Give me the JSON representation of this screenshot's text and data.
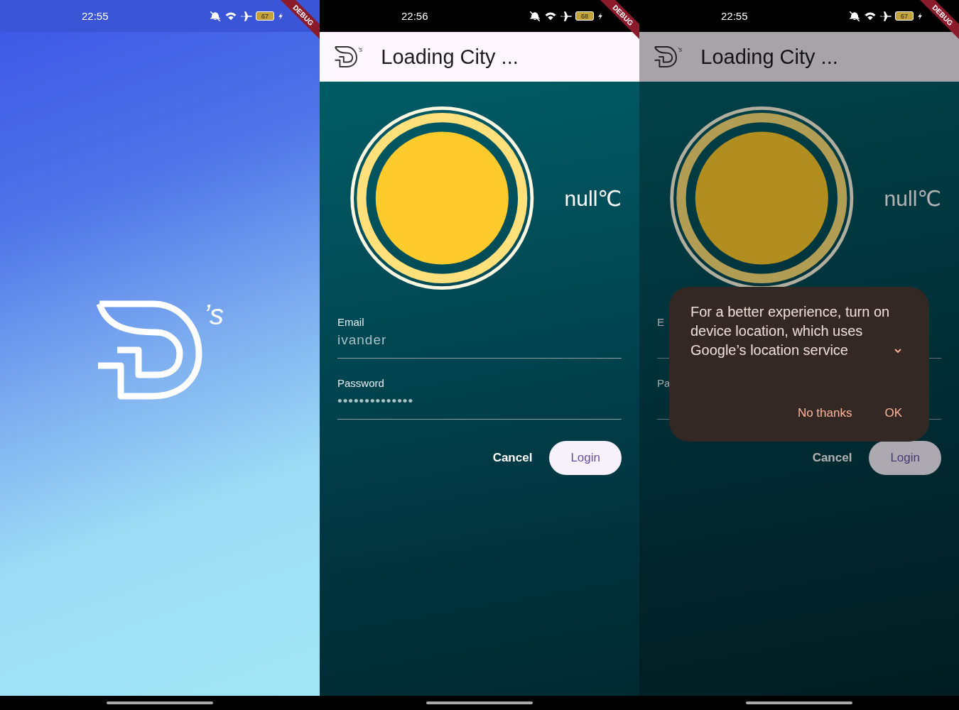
{
  "screens": [
    {
      "kind": "splash",
      "status_bar": {
        "time": "22:55",
        "battery": "67"
      },
      "debug_banner": "DEBUG",
      "logo_suffix": "’s"
    },
    {
      "kind": "login",
      "dimmed": false,
      "status_bar": {
        "time": "22:56",
        "battery": "68"
      },
      "debug_banner": "DEBUG",
      "app_bar": {
        "logo_suffix": "’s",
        "title": "Loading City ..."
      },
      "weather": {
        "temperature": "null℃"
      },
      "fields": [
        {
          "label": "Email",
          "value": "ivander"
        },
        {
          "label": "Password",
          "value": "••••••••••••••"
        }
      ],
      "buttons": [
        {
          "kind": "text",
          "label": "Cancel"
        },
        {
          "kind": "filled",
          "label": "Login"
        }
      ]
    },
    {
      "kind": "login",
      "dimmed": true,
      "status_bar": {
        "time": "22:55",
        "battery": "67"
      },
      "debug_banner": "DEBUG",
      "app_bar": {
        "logo_suffix": "’s",
        "title": "Loading City ..."
      },
      "weather": {
        "temperature": "null℃"
      },
      "fields": [
        {
          "label": "E"
        },
        {
          "label": "Pa"
        }
      ],
      "buttons": [
        {
          "kind": "text",
          "label": "Cancel"
        },
        {
          "kind": "filled",
          "label": "Login"
        }
      ],
      "dialog": {
        "message": "For a better experience, turn on device location, which uses Google’s location service",
        "actions": [
          {
            "label": "No thanks"
          },
          {
            "label": "OK"
          }
        ]
      }
    }
  ]
}
